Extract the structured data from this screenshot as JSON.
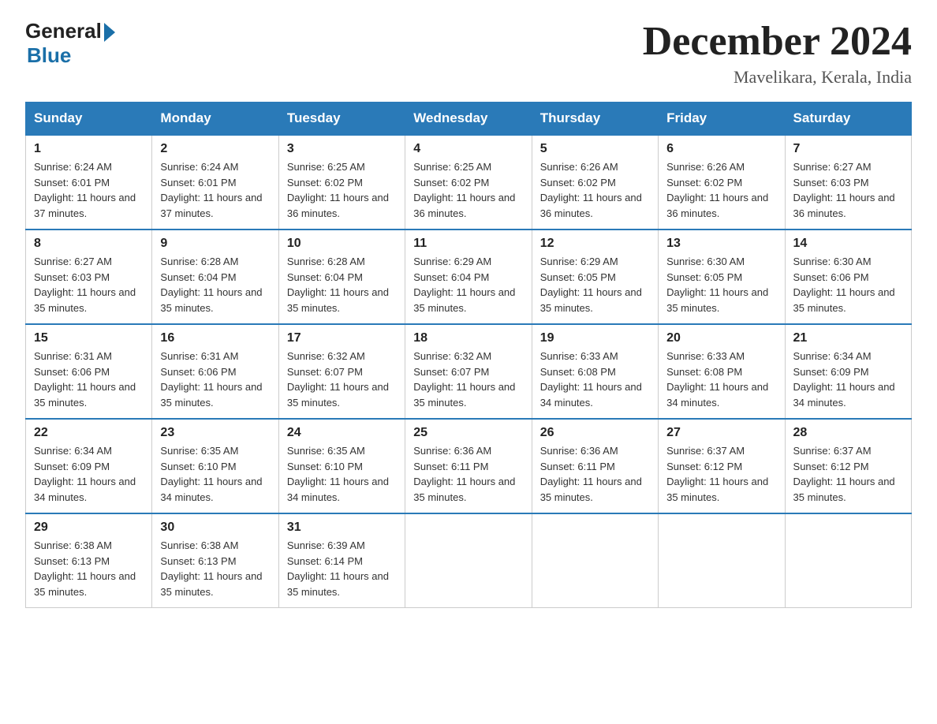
{
  "logo": {
    "general": "General",
    "blue": "Blue"
  },
  "title": "December 2024",
  "subtitle": "Mavelikara, Kerala, India",
  "days_of_week": [
    "Sunday",
    "Monday",
    "Tuesday",
    "Wednesday",
    "Thursday",
    "Friday",
    "Saturday"
  ],
  "weeks": [
    [
      {
        "day": "1",
        "sunrise": "Sunrise: 6:24 AM",
        "sunset": "Sunset: 6:01 PM",
        "daylight": "Daylight: 11 hours and 37 minutes."
      },
      {
        "day": "2",
        "sunrise": "Sunrise: 6:24 AM",
        "sunset": "Sunset: 6:01 PM",
        "daylight": "Daylight: 11 hours and 37 minutes."
      },
      {
        "day": "3",
        "sunrise": "Sunrise: 6:25 AM",
        "sunset": "Sunset: 6:02 PM",
        "daylight": "Daylight: 11 hours and 36 minutes."
      },
      {
        "day": "4",
        "sunrise": "Sunrise: 6:25 AM",
        "sunset": "Sunset: 6:02 PM",
        "daylight": "Daylight: 11 hours and 36 minutes."
      },
      {
        "day": "5",
        "sunrise": "Sunrise: 6:26 AM",
        "sunset": "Sunset: 6:02 PM",
        "daylight": "Daylight: 11 hours and 36 minutes."
      },
      {
        "day": "6",
        "sunrise": "Sunrise: 6:26 AM",
        "sunset": "Sunset: 6:02 PM",
        "daylight": "Daylight: 11 hours and 36 minutes."
      },
      {
        "day": "7",
        "sunrise": "Sunrise: 6:27 AM",
        "sunset": "Sunset: 6:03 PM",
        "daylight": "Daylight: 11 hours and 36 minutes."
      }
    ],
    [
      {
        "day": "8",
        "sunrise": "Sunrise: 6:27 AM",
        "sunset": "Sunset: 6:03 PM",
        "daylight": "Daylight: 11 hours and 35 minutes."
      },
      {
        "day": "9",
        "sunrise": "Sunrise: 6:28 AM",
        "sunset": "Sunset: 6:04 PM",
        "daylight": "Daylight: 11 hours and 35 minutes."
      },
      {
        "day": "10",
        "sunrise": "Sunrise: 6:28 AM",
        "sunset": "Sunset: 6:04 PM",
        "daylight": "Daylight: 11 hours and 35 minutes."
      },
      {
        "day": "11",
        "sunrise": "Sunrise: 6:29 AM",
        "sunset": "Sunset: 6:04 PM",
        "daylight": "Daylight: 11 hours and 35 minutes."
      },
      {
        "day": "12",
        "sunrise": "Sunrise: 6:29 AM",
        "sunset": "Sunset: 6:05 PM",
        "daylight": "Daylight: 11 hours and 35 minutes."
      },
      {
        "day": "13",
        "sunrise": "Sunrise: 6:30 AM",
        "sunset": "Sunset: 6:05 PM",
        "daylight": "Daylight: 11 hours and 35 minutes."
      },
      {
        "day": "14",
        "sunrise": "Sunrise: 6:30 AM",
        "sunset": "Sunset: 6:06 PM",
        "daylight": "Daylight: 11 hours and 35 minutes."
      }
    ],
    [
      {
        "day": "15",
        "sunrise": "Sunrise: 6:31 AM",
        "sunset": "Sunset: 6:06 PM",
        "daylight": "Daylight: 11 hours and 35 minutes."
      },
      {
        "day": "16",
        "sunrise": "Sunrise: 6:31 AM",
        "sunset": "Sunset: 6:06 PM",
        "daylight": "Daylight: 11 hours and 35 minutes."
      },
      {
        "day": "17",
        "sunrise": "Sunrise: 6:32 AM",
        "sunset": "Sunset: 6:07 PM",
        "daylight": "Daylight: 11 hours and 35 minutes."
      },
      {
        "day": "18",
        "sunrise": "Sunrise: 6:32 AM",
        "sunset": "Sunset: 6:07 PM",
        "daylight": "Daylight: 11 hours and 35 minutes."
      },
      {
        "day": "19",
        "sunrise": "Sunrise: 6:33 AM",
        "sunset": "Sunset: 6:08 PM",
        "daylight": "Daylight: 11 hours and 34 minutes."
      },
      {
        "day": "20",
        "sunrise": "Sunrise: 6:33 AM",
        "sunset": "Sunset: 6:08 PM",
        "daylight": "Daylight: 11 hours and 34 minutes."
      },
      {
        "day": "21",
        "sunrise": "Sunrise: 6:34 AM",
        "sunset": "Sunset: 6:09 PM",
        "daylight": "Daylight: 11 hours and 34 minutes."
      }
    ],
    [
      {
        "day": "22",
        "sunrise": "Sunrise: 6:34 AM",
        "sunset": "Sunset: 6:09 PM",
        "daylight": "Daylight: 11 hours and 34 minutes."
      },
      {
        "day": "23",
        "sunrise": "Sunrise: 6:35 AM",
        "sunset": "Sunset: 6:10 PM",
        "daylight": "Daylight: 11 hours and 34 minutes."
      },
      {
        "day": "24",
        "sunrise": "Sunrise: 6:35 AM",
        "sunset": "Sunset: 6:10 PM",
        "daylight": "Daylight: 11 hours and 34 minutes."
      },
      {
        "day": "25",
        "sunrise": "Sunrise: 6:36 AM",
        "sunset": "Sunset: 6:11 PM",
        "daylight": "Daylight: 11 hours and 35 minutes."
      },
      {
        "day": "26",
        "sunrise": "Sunrise: 6:36 AM",
        "sunset": "Sunset: 6:11 PM",
        "daylight": "Daylight: 11 hours and 35 minutes."
      },
      {
        "day": "27",
        "sunrise": "Sunrise: 6:37 AM",
        "sunset": "Sunset: 6:12 PM",
        "daylight": "Daylight: 11 hours and 35 minutes."
      },
      {
        "day": "28",
        "sunrise": "Sunrise: 6:37 AM",
        "sunset": "Sunset: 6:12 PM",
        "daylight": "Daylight: 11 hours and 35 minutes."
      }
    ],
    [
      {
        "day": "29",
        "sunrise": "Sunrise: 6:38 AM",
        "sunset": "Sunset: 6:13 PM",
        "daylight": "Daylight: 11 hours and 35 minutes."
      },
      {
        "day": "30",
        "sunrise": "Sunrise: 6:38 AM",
        "sunset": "Sunset: 6:13 PM",
        "daylight": "Daylight: 11 hours and 35 minutes."
      },
      {
        "day": "31",
        "sunrise": "Sunrise: 6:39 AM",
        "sunset": "Sunset: 6:14 PM",
        "daylight": "Daylight: 11 hours and 35 minutes."
      },
      null,
      null,
      null,
      null
    ]
  ]
}
